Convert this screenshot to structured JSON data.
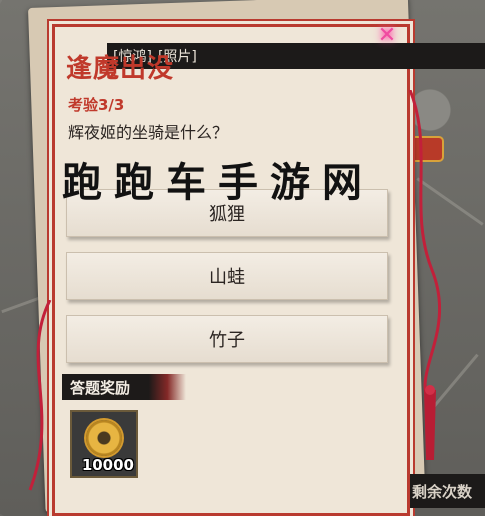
{
  "dialog": {
    "title_partial": "逢魔出没",
    "tags": [
      "[惊鸿]",
      "[照片]"
    ],
    "test_progress": "考验3/3",
    "question": "辉夜姬的坐骑是什么？",
    "watermark": "跑跑车手游网",
    "options": [
      "狐狸",
      "山蛙",
      "竹子"
    ],
    "reward_label": "答题奖励",
    "reward_quantity": "10000"
  },
  "side_panel": {
    "remaining_partial": "剩余次数"
  },
  "colors": {
    "accent": "#c0392b",
    "paper": "#efe6d8",
    "dark_bar": "#1c1a19"
  }
}
